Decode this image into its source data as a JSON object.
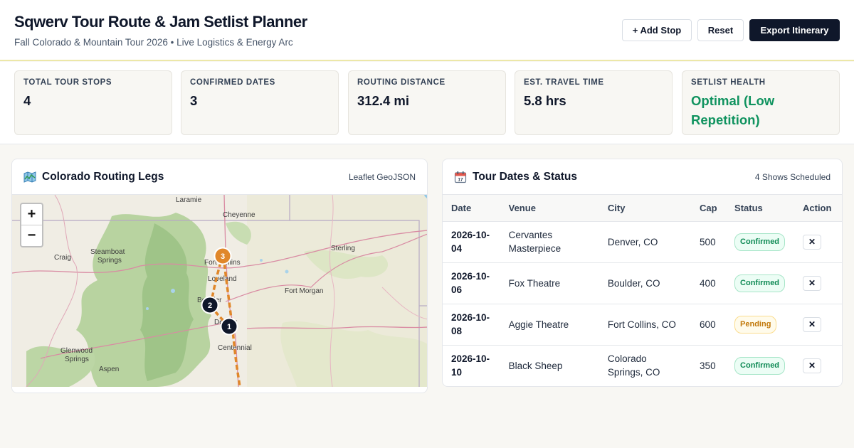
{
  "header": {
    "title": "Sqwerv Tour Route & Jam Setlist Planner",
    "subtitle": "Fall Colorado & Mountain Tour 2026 • Live Logistics & Energy Arc",
    "buttons": {
      "add_stop": "+ Add Stop",
      "reset": "Reset",
      "export": "Export Itinerary"
    }
  },
  "stats": [
    {
      "label": "TOTAL TOUR STOPS",
      "value": "4"
    },
    {
      "label": "CONFIRMED DATES",
      "value": "3"
    },
    {
      "label": "ROUTING DISTANCE",
      "value": "312.4 mi"
    },
    {
      "label": "EST. TRAVEL TIME",
      "value": "5.8 hrs"
    },
    {
      "label": "SETLIST HEALTH",
      "value": "Optimal (Low Repetition)"
    }
  ],
  "map_panel": {
    "title": "Colorado Routing Legs",
    "icon": "map-icon",
    "tag": "Leaflet GeoJSON",
    "zoom_in": "+",
    "zoom_out": "−",
    "places": [
      "Laramie",
      "Cheyenne",
      "Sterling",
      "Steamboat",
      "Springs",
      "Craig",
      "Fort Collins",
      "Loveland",
      "Fort Morgan",
      "Boulder",
      "Denver",
      "Centennial",
      "Glenwood",
      "Springs",
      "Aspen"
    ],
    "markers": [
      "1",
      "2",
      "3"
    ],
    "colors": {
      "route": "#e0872a",
      "marker_dark": "#0f172a",
      "marker_active": "#e0872a"
    }
  },
  "dates_panel": {
    "title": "Tour Dates & Status",
    "icon": "calendar-icon",
    "tag": "4 Shows Scheduled",
    "columns": [
      "Date",
      "Venue",
      "City",
      "Cap",
      "Status",
      "Action"
    ],
    "rows": [
      {
        "date": "2026-10-04",
        "venue": "Cervantes Masterpiece",
        "city": "Denver, CO",
        "cap": "500",
        "status": "Confirmed",
        "action": "✕"
      },
      {
        "date": "2026-10-06",
        "venue": "Fox Theatre",
        "city": "Boulder, CO",
        "cap": "400",
        "status": "Confirmed",
        "action": "✕"
      },
      {
        "date": "2026-10-08",
        "venue": "Aggie Theatre",
        "city": "Fort Collins, CO",
        "cap": "600",
        "status": "Pending",
        "action": "✕"
      },
      {
        "date": "2026-10-10",
        "venue": "Black Sheep",
        "city": "Colorado Springs, CO",
        "cap": "350",
        "status": "Confirmed",
        "action": "✕"
      }
    ]
  }
}
